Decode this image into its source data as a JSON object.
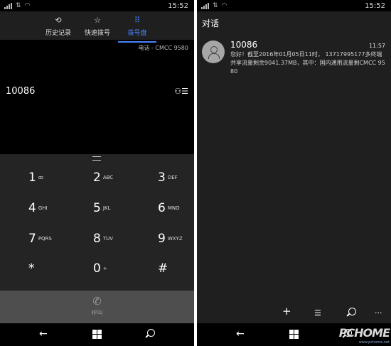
{
  "left": {
    "status": {
      "time": "15:52"
    },
    "tabs": [
      {
        "label": "历史记录",
        "icon": "history-icon",
        "glyph": "⟲"
      },
      {
        "label": "快速拨号",
        "icon": "star-icon",
        "glyph": "☆"
      },
      {
        "label": "拨号盘",
        "icon": "dialpad-icon",
        "glyph": "⠿",
        "active": true
      }
    ],
    "line_info": "电话 - CMCC 9580",
    "dialed_number": "10086",
    "keys": [
      {
        "digit": "1",
        "sub": "ꝏ"
      },
      {
        "digit": "2",
        "sub": "ABC"
      },
      {
        "digit": "3",
        "sub": "DEF"
      },
      {
        "digit": "4",
        "sub": "GHI"
      },
      {
        "digit": "5",
        "sub": "JKL"
      },
      {
        "digit": "6",
        "sub": "MNO"
      },
      {
        "digit": "7",
        "sub": "PQRS"
      },
      {
        "digit": "8",
        "sub": "TUV"
      },
      {
        "digit": "9",
        "sub": "WXYZ"
      },
      {
        "digit": "*",
        "sub": ""
      },
      {
        "digit": "0",
        "sub": "+"
      },
      {
        "digit": "#",
        "sub": ""
      }
    ],
    "call": {
      "label": "呼叫",
      "glyph": "✆"
    },
    "nav": {
      "back": "←",
      "search": "search-icon"
    }
  },
  "right": {
    "status": {
      "time": "15:52"
    },
    "title": "对话",
    "message": {
      "sender": "10086",
      "time": "11:57",
      "body": "您好！截至2016年01月05日11时， 13717995177多终端共享流量剩余9041.37MB，其中：国内通用流量剩CMCC 9580"
    },
    "appbar": {
      "add": "+",
      "select": "☰",
      "more": "···"
    }
  },
  "watermark": {
    "main": "PCHOME",
    "sub": "www.pchome.net"
  },
  "colors": {
    "accent": "#4b84ff"
  }
}
